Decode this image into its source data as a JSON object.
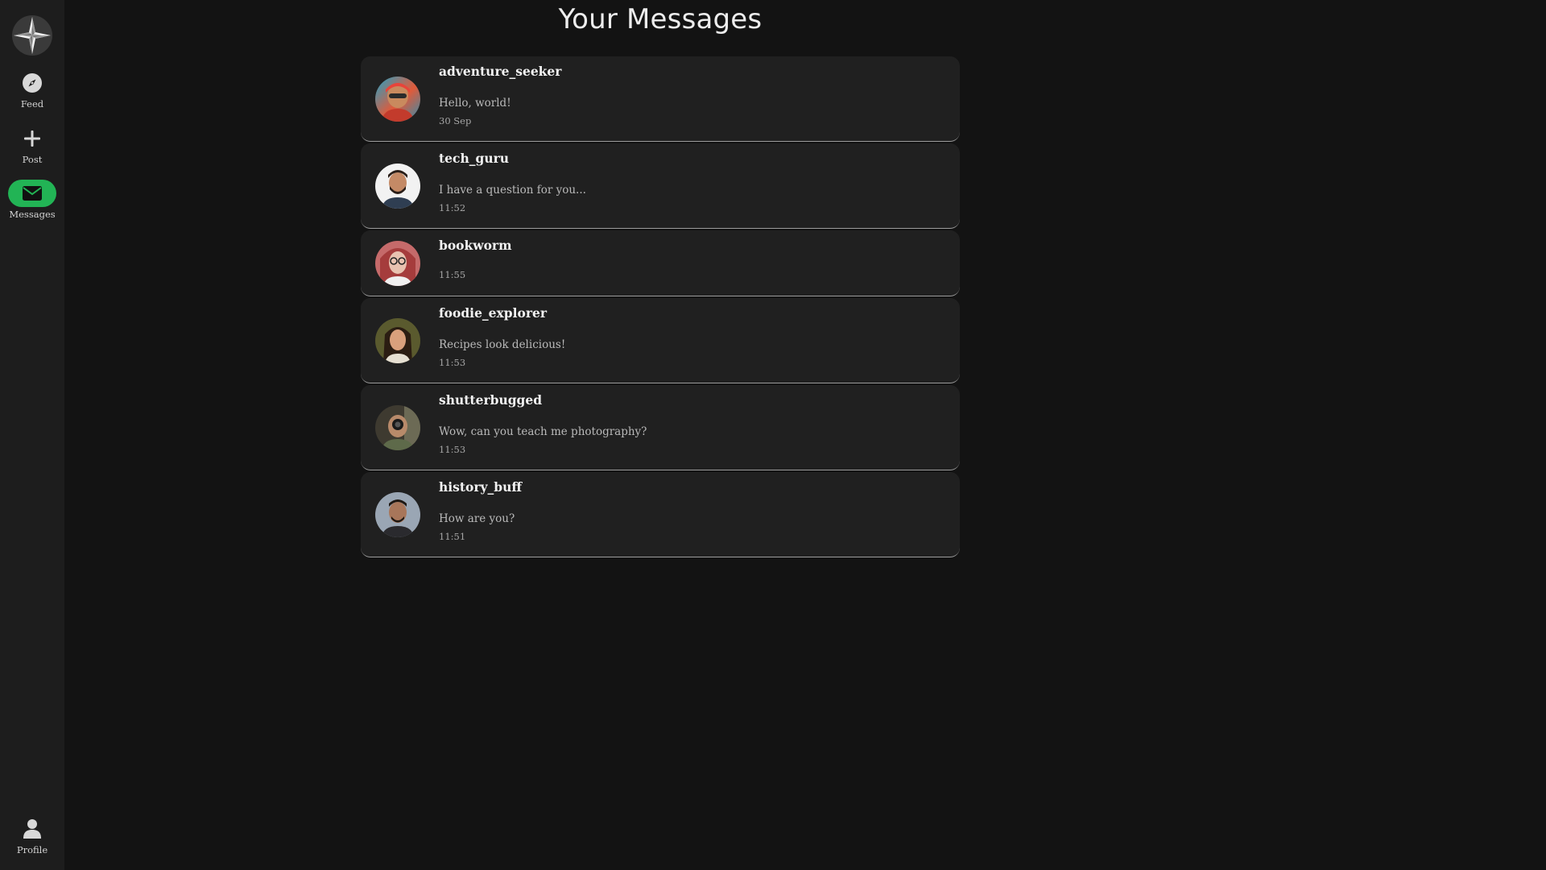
{
  "page": {
    "title": "Your Messages"
  },
  "sidebar": {
    "logo_icon": "compass-star-icon",
    "items": [
      {
        "label": "Feed",
        "icon": "compass-icon",
        "active": false
      },
      {
        "label": "Post",
        "icon": "plus-icon",
        "active": false
      },
      {
        "label": "Messages",
        "icon": "envelope-icon",
        "active": true
      },
      {
        "label": "Profile",
        "icon": "user-icon",
        "active": false
      }
    ],
    "active_color": "#22b455"
  },
  "conversations": [
    {
      "username": "adventure_seeker",
      "preview": "Hello, world!",
      "time": "30 Sep",
      "avatar_icon": "avatar-photo"
    },
    {
      "username": "tech_guru",
      "preview": "I have a question for you...",
      "time": "11:52",
      "avatar_icon": "avatar-photo"
    },
    {
      "username": "bookworm",
      "preview": "",
      "time": "11:55",
      "avatar_icon": "avatar-photo"
    },
    {
      "username": "foodie_explorer",
      "preview": "Recipes look delicious!",
      "time": "11:53",
      "avatar_icon": "avatar-photo"
    },
    {
      "username": "shutterbugged",
      "preview": "Wow, can you teach me photography?",
      "time": "11:53",
      "avatar_icon": "avatar-photo"
    },
    {
      "username": "history_buff",
      "preview": "How are you?",
      "time": "11:51",
      "avatar_icon": "avatar-photo"
    }
  ]
}
